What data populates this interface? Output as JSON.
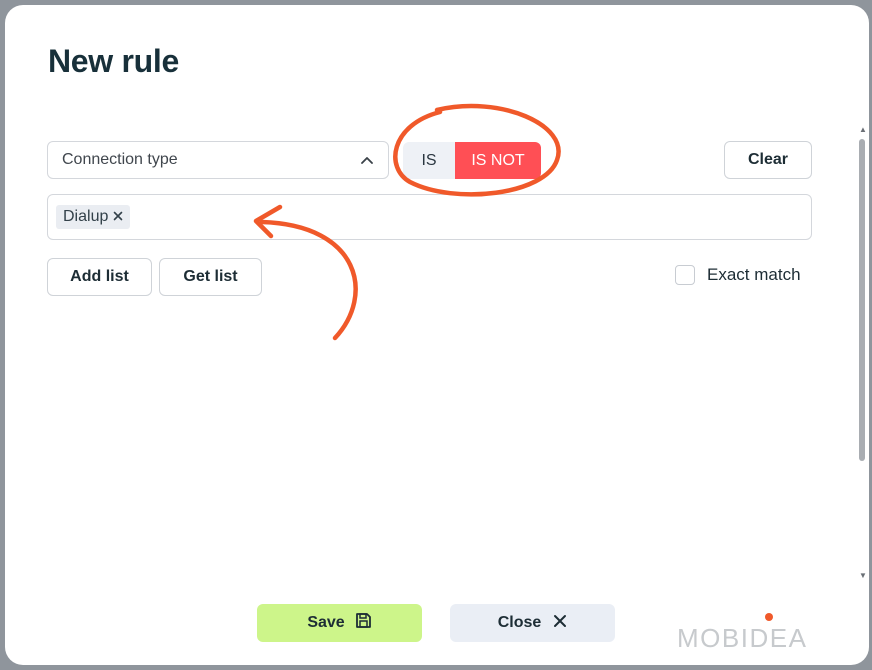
{
  "modal": {
    "title": "New rule"
  },
  "rule": {
    "field_select": {
      "value": "Connection type"
    },
    "toggle": {
      "is_label": "IS",
      "is_not_label": "IS NOT",
      "selected": "IS NOT"
    },
    "clear_label": "Clear",
    "tags": [
      {
        "label": "Dialup"
      }
    ],
    "add_list_label": "Add list",
    "get_list_label": "Get list",
    "exact_match": {
      "label": "Exact match",
      "checked": false
    }
  },
  "footer": {
    "save_label": "Save",
    "close_label": "Close"
  },
  "brand": {
    "logo_text": "MOBIDEA",
    "accent_color": "#f0592a"
  },
  "colors": {
    "is_not_active": "#ff4f55",
    "save_bg": "#cdf58a",
    "annotation": "#f0592a"
  },
  "icons": {
    "select_caret": "chevron-up-icon",
    "chip_remove": "close-icon",
    "save": "floppy-disk-icon",
    "close": "close-icon"
  }
}
